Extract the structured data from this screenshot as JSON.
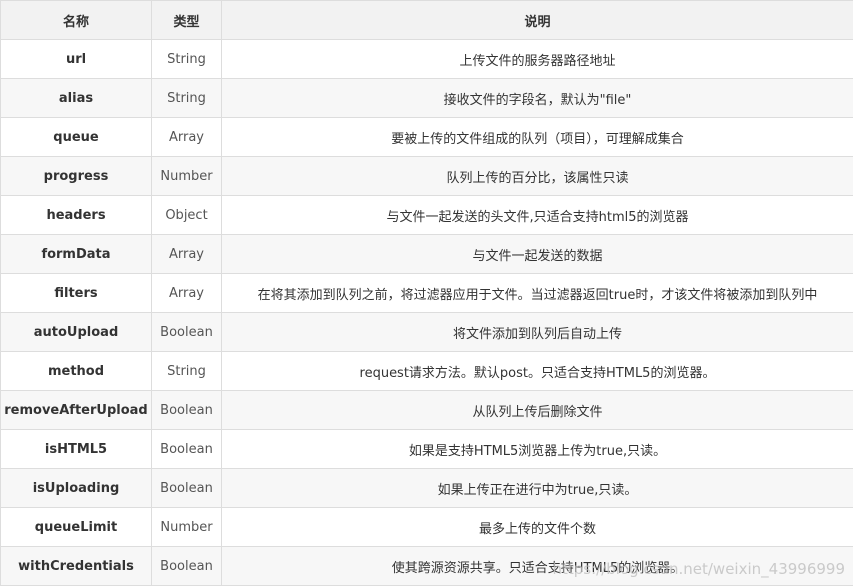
{
  "table": {
    "headers": [
      "名称",
      "类型",
      "说明"
    ],
    "rows": [
      {
        "name": "url",
        "type": "String",
        "desc": "上传文件的服务器路径地址"
      },
      {
        "name": "alias",
        "type": "String",
        "desc": "接收文件的字段名，默认为\"file\""
      },
      {
        "name": "queue",
        "type": "Array",
        "desc": "要被上传的文件组成的队列（项目），可理解成集合"
      },
      {
        "name": "progress",
        "type": "Number",
        "desc": "队列上传的百分比，该属性只读"
      },
      {
        "name": "headers",
        "type": "Object",
        "desc": "与文件一起发送的头文件,只适合支持html5的浏览器"
      },
      {
        "name": "formData",
        "type": "Array",
        "desc": "与文件一起发送的数据"
      },
      {
        "name": "filters",
        "type": "Array",
        "desc": "在将其添加到队列之前，将过滤器应用于文件。当过滤器返回true时，才该文件将被添加到队列中"
      },
      {
        "name": "autoUpload",
        "type": "Boolean",
        "desc": "将文件添加到队列后自动上传"
      },
      {
        "name": "method",
        "type": "String",
        "desc": "request请求方法。默认post。只适合支持HTML5的浏览器。"
      },
      {
        "name": "removeAfterUpload",
        "type": "Boolean",
        "desc": "从队列上传后删除文件"
      },
      {
        "name": "isHTML5",
        "type": "Boolean",
        "desc": "如果是支持HTML5浏览器上传为true,只读。"
      },
      {
        "name": "isUploading",
        "type": "Boolean",
        "desc": "如果上传正在进行中为true,只读。"
      },
      {
        "name": "queueLimit",
        "type": "Number",
        "desc": "最多上传的文件个数"
      },
      {
        "name": "withCredentials",
        "type": "Boolean",
        "desc": "使其跨源资源共享。只适合支持HTML5的浏览器。"
      }
    ]
  },
  "watermark": "https://blog.csdn.net/weixin_43996999"
}
